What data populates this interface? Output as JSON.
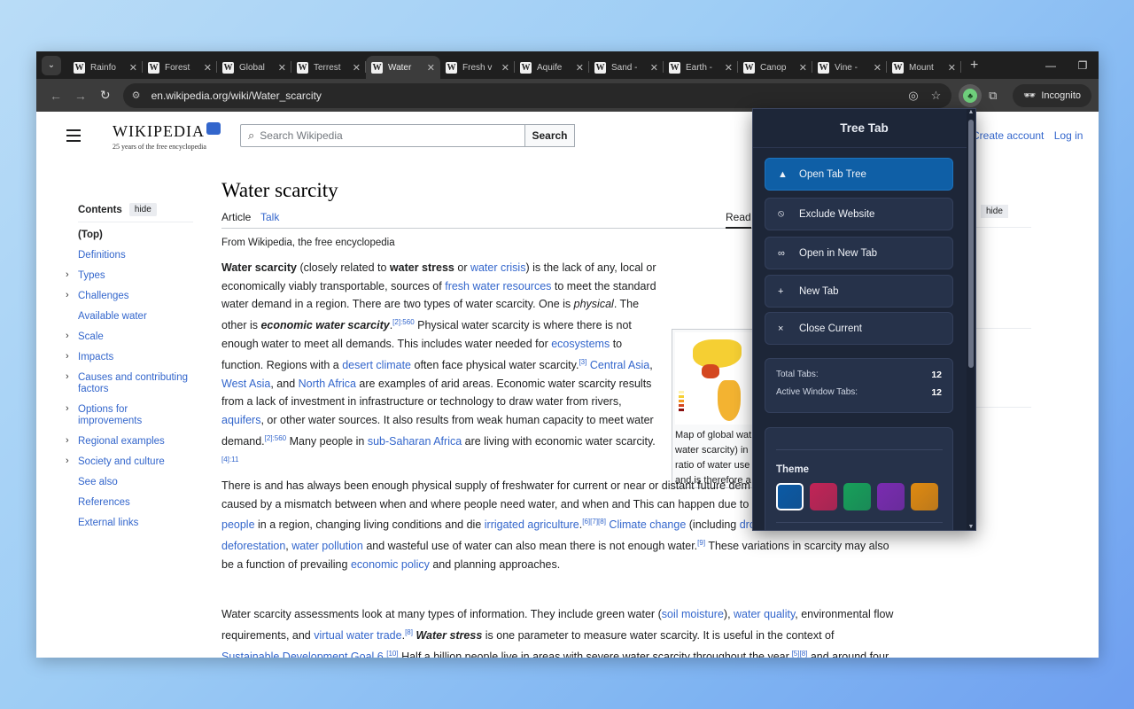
{
  "tabs": [
    {
      "title": "Rainfo",
      "active": false
    },
    {
      "title": "Forest",
      "active": false
    },
    {
      "title": "Global",
      "active": false
    },
    {
      "title": "Terrest",
      "active": false
    },
    {
      "title": "Water",
      "active": true
    },
    {
      "title": "Fresh v",
      "active": false
    },
    {
      "title": "Aquife",
      "active": false
    },
    {
      "title": "Sand -",
      "active": false
    },
    {
      "title": "Earth -",
      "active": false
    },
    {
      "title": "Canop",
      "active": false
    },
    {
      "title": "Vine -",
      "active": false
    },
    {
      "title": "Mount",
      "active": false
    }
  ],
  "favicon_letter": "W",
  "toolbar": {
    "url": "en.wikipedia.org/wiki/Water_scarcity",
    "incognito_label": "Incognito"
  },
  "wiki": {
    "logo_wordmark": "WIKIPEDIA",
    "logo_tagline": "25 years of the free encyclopedia",
    "search_placeholder": "Search Wikipedia",
    "search_button": "Search",
    "create_account": "Create account",
    "log_in": "Log in",
    "title": "Water scarcity",
    "tab_article": "Article",
    "tab_talk": "Talk",
    "tab_read": "Read",
    "from": "From Wikipedia, the free encyclopedia",
    "toc_title": "Contents",
    "toc_hide": "hide",
    "right_hide": "hide",
    "toc": [
      {
        "label": "(Top)",
        "chev": false
      },
      {
        "label": "Definitions",
        "chev": false
      },
      {
        "label": "Types",
        "chev": true
      },
      {
        "label": "Challenges",
        "chev": true
      },
      {
        "label": "Available water",
        "chev": false
      },
      {
        "label": "Scale",
        "chev": true
      },
      {
        "label": "Impacts",
        "chev": true
      },
      {
        "label": "Causes and contributing factors",
        "chev": true
      },
      {
        "label": "Options for improvements",
        "chev": true
      },
      {
        "label": "Regional examples",
        "chev": true
      },
      {
        "label": "Society and culture",
        "chev": true
      },
      {
        "label": "See also",
        "chev": false
      },
      {
        "label": "References",
        "chev": false
      },
      {
        "label": "External links",
        "chev": false
      }
    ],
    "figure_caption": [
      "Map of global wat",
      "water scarcity) in",
      "ratio of water use",
      "and is therefore a"
    ]
  },
  "popup": {
    "title": "Tree Tab",
    "buttons": [
      {
        "label": "Open Tab Tree",
        "icon": "leaf-icon",
        "glyph": "▲"
      },
      {
        "label": "Exclude Website",
        "icon": "block-icon",
        "glyph": "⦸"
      },
      {
        "label": "Open in New Tab",
        "icon": "link-icon",
        "glyph": "∞"
      },
      {
        "label": "New Tab",
        "icon": "plus-icon",
        "glyph": "+"
      },
      {
        "label": "Close Current",
        "icon": "close-icon",
        "glyph": "×"
      }
    ],
    "total_tabs_label": "Total Tabs:",
    "total_tabs_value": "12",
    "active_window_tabs_label": "Active Window Tabs:",
    "active_window_tabs_value": "12",
    "theme_label": "Theme",
    "themes": [
      "#0b5aa5",
      "#c22456",
      "#17a05a",
      "#7a2bb0",
      "#e08a10"
    ]
  }
}
